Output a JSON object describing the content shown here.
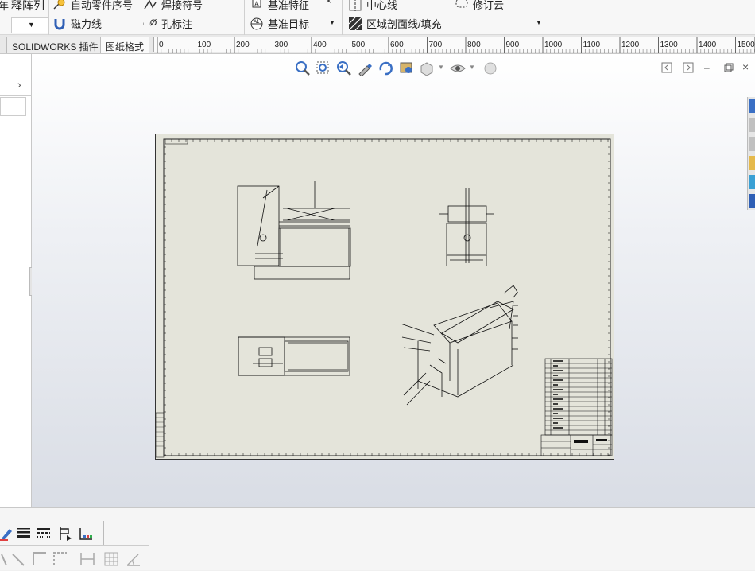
{
  "ribbon": {
    "col1_top": "释阵列",
    "col1_left": "年",
    "auto_balloon": "自动零件序号",
    "magnetic_line": "磁力线",
    "weld_symbol": "焊接符号",
    "hole_callout": "孔标注",
    "datum_feature": "基准特征",
    "datum_target": "基准目标",
    "centerline": "中心线",
    "area_hatch": "区域剖面线/填充",
    "revision_cloud": "修订云",
    "x_mark": "×"
  },
  "tabs": [
    {
      "label": "SOLIDWORKS 插件"
    },
    {
      "label": "图纸格式"
    }
  ],
  "ruler": {
    "ticks": [
      "0",
      "100",
      "200",
      "300",
      "400",
      "500",
      "600",
      "700",
      "800",
      "900",
      "1000",
      "1100",
      "1200",
      "1300",
      "1400",
      "1500"
    ]
  },
  "sheet": {
    "bom_rows": 16
  },
  "colors": {
    "sheet_bg": "#e4e4da",
    "ribbon_bg": "#f7f7f7",
    "accent": "#3a6fc4"
  }
}
